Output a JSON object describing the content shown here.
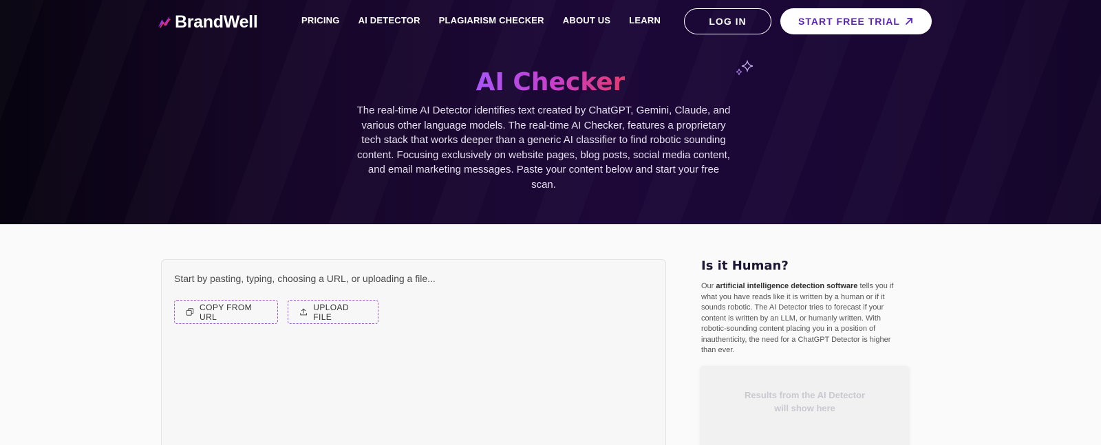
{
  "header": {
    "brand": "BrandWell",
    "nav": [
      {
        "label": "PRICING"
      },
      {
        "label": "AI DETECTOR"
      },
      {
        "label": "PLAGIARISM CHECKER"
      },
      {
        "label": "ABOUT US"
      },
      {
        "label": "LEARN"
      }
    ],
    "login_label": "LOG IN",
    "trial_label": "START FREE TRIAL"
  },
  "hero": {
    "title": "AI Checker",
    "description": "The real-time AI Detector identifies text created by ChatGPT, Gemini, Claude, and various other language models. The real-time AI Checker, features a proprietary tech stack that works deeper than a generic AI classifier to find robotic sounding content. Focusing exclusively on website pages, blog posts, social media content, and email marketing messages. Paste your content below and start your free scan."
  },
  "editor": {
    "placeholder": "Start by pasting, typing, choosing a URL, or uploading a file...",
    "copy_url_label": "COPY FROM URL",
    "upload_label": "UPLOAD FILE"
  },
  "sidebar": {
    "title": "Is it Human?",
    "desc_prefix": "Our ",
    "desc_bold": "artificial intelligence detection software",
    "desc_rest": " tells you if what you have reads like it is written by a human or if it sounds robotic. The AI Detector tries to forecast if your content is written by an LLM, or humanly written. With robotic-sounding content placing you in a position of inauthenticity, the need for a ChatGPT Detector is higher than ever.",
    "results_line1": "Results from the AI Detector",
    "results_line2": "will show here"
  },
  "colors": {
    "hero_bg": "#1d0838",
    "accent_purple": "#5b22b8",
    "title_gradient_start": "#a855f7",
    "title_gradient_end": "#e23a6f",
    "dashed_border": "#9b59d6"
  },
  "icons": {
    "logo": "brandwell-logo-icon",
    "trial_arrow": "arrow-up-right-icon",
    "sparkle": "sparkle-icon",
    "copy": "copy-icon",
    "upload": "upload-icon"
  }
}
